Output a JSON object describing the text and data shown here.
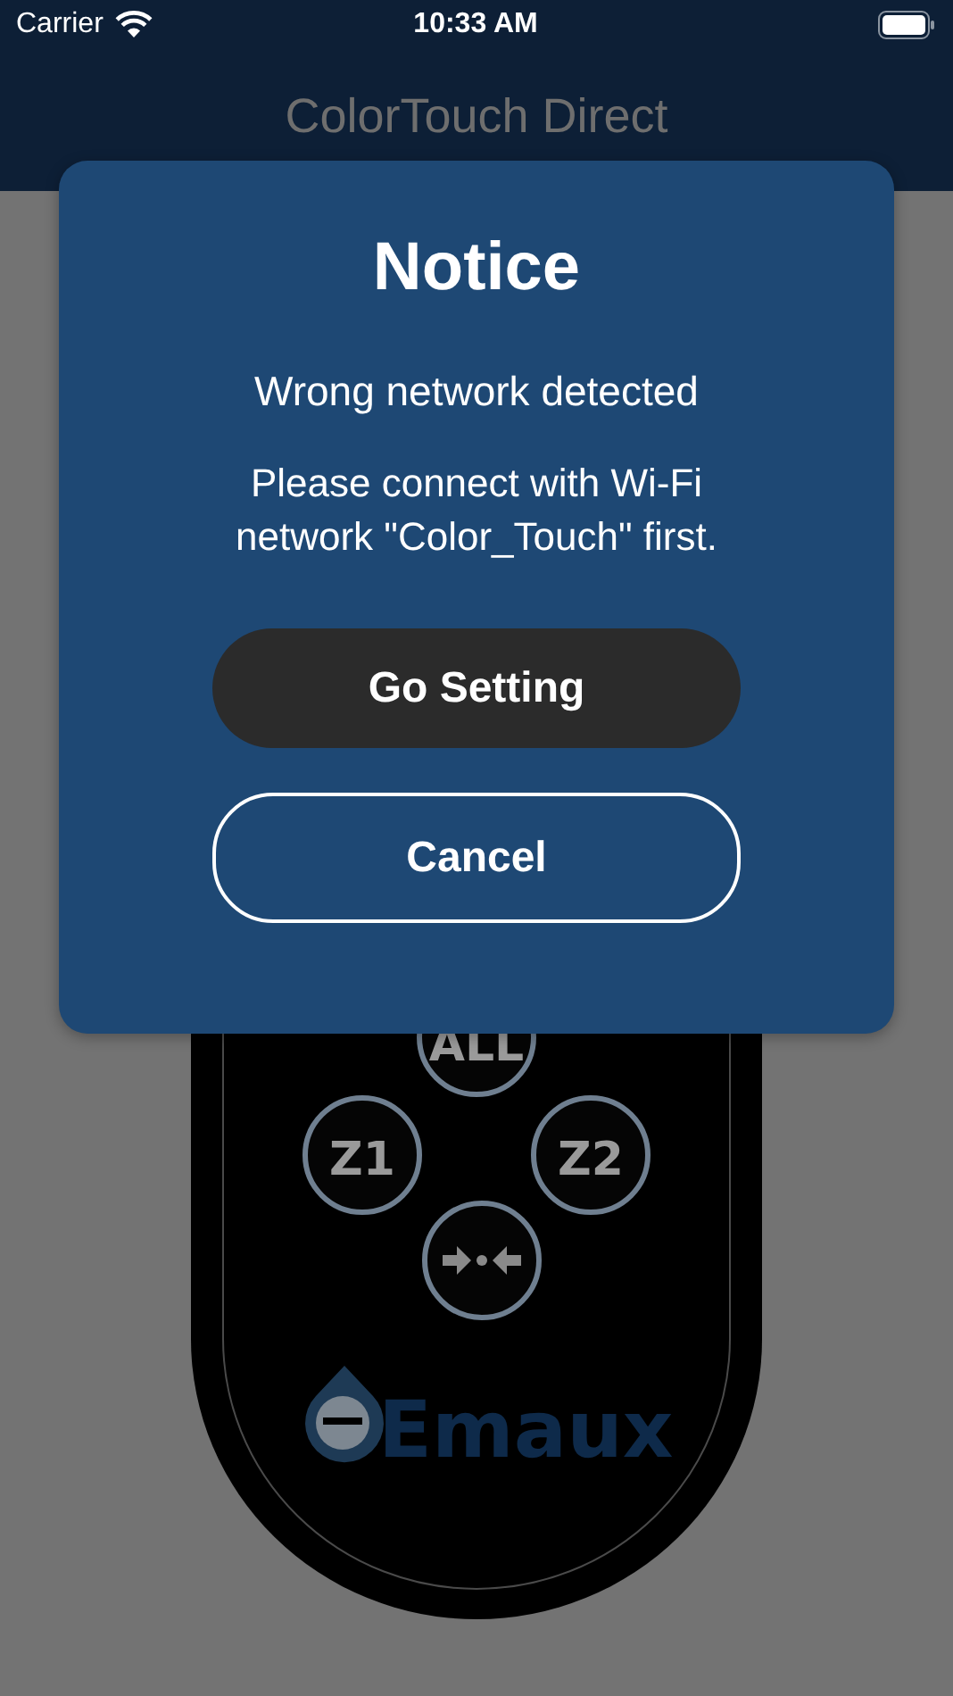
{
  "status_bar": {
    "carrier": "Carrier",
    "time": "10:33 AM"
  },
  "nav_bar": {
    "title": "ColorTouch Direct"
  },
  "remote": {
    "buttons": [
      {
        "label": "ALL",
        "kind": "text"
      },
      {
        "label": "Z1",
        "kind": "text"
      },
      {
        "label": "Z2",
        "kind": "text"
      },
      {
        "kind": "icon"
      }
    ],
    "brand": "Emaux"
  },
  "dialog": {
    "title": "Notice",
    "heading": "Wrong network detected",
    "message": "Please connect with Wi-Fi network \"Color_Touch\" first.",
    "buttons": [
      {
        "label": "Go Setting",
        "kind": "filled"
      },
      {
        "label": "Cancel",
        "kind": "outline"
      }
    ]
  }
}
